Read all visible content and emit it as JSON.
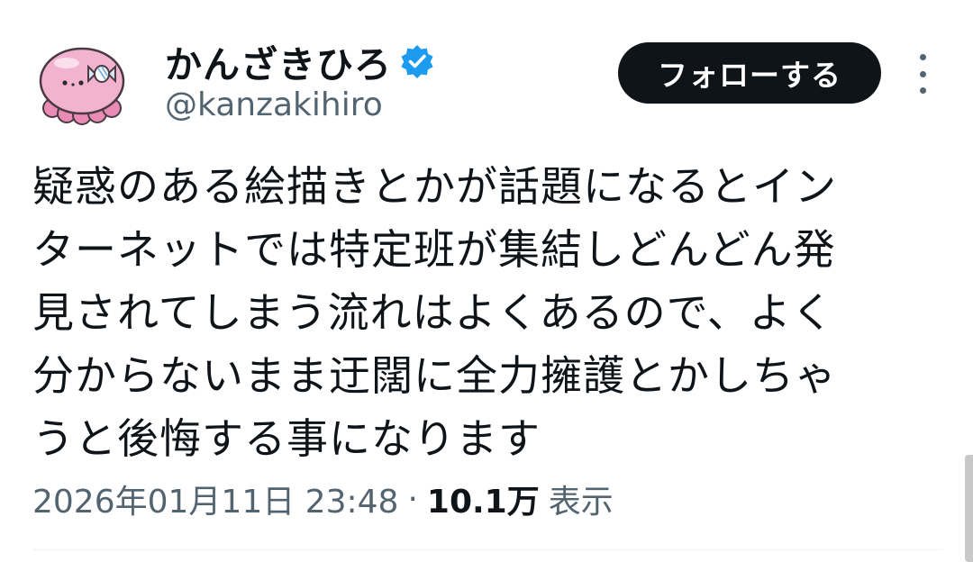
{
  "author": {
    "display_name": "かんざきひろ",
    "handle": "@kanzakihiro",
    "verified_icon": "verified-badge-icon",
    "verified_color": "#1d9bf0"
  },
  "actions": {
    "follow_label": "フォローする",
    "more_icon": "more-vertical-icon"
  },
  "tweet": {
    "text": "疑惑のある絵描きとかが話題になるとイン\nターネットでは特定班が集結しどんどん発\n見されてしまう流れはよくあるので、よく\n分からないまま迂闊に全力擁護とかしちゃ\nうと後悔する事になります"
  },
  "meta": {
    "timestamp": "2026年01月11日 23:48",
    "separator": "·",
    "views_count": "10.1万",
    "views_label": "表示"
  },
  "colors": {
    "text_primary": "#0f1419",
    "text_secondary": "#536471",
    "follow_bg": "#0f1419",
    "avatar_pink": "#f2a6c8"
  }
}
